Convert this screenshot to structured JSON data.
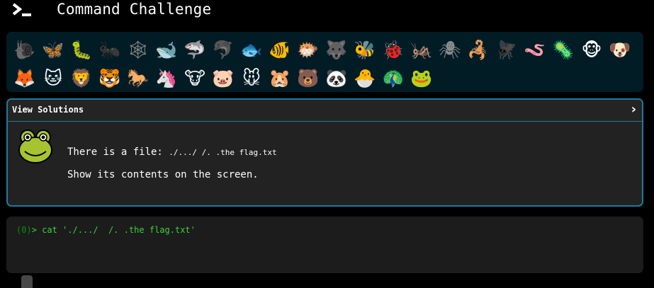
{
  "header": {
    "title": "Command Challenge",
    "logo_icon": "terminal-prompt-icon"
  },
  "animals": {
    "row1": [
      {
        "name": "snail",
        "glyph": "🐌",
        "locked": true
      },
      {
        "name": "butterfly",
        "glyph": "🦋",
        "locked": false
      },
      {
        "name": "caterpillar",
        "glyph": "🐛",
        "locked": false
      },
      {
        "name": "ant",
        "glyph": "🐜",
        "locked": true
      },
      {
        "name": "spider-web",
        "glyph": "🕸",
        "locked": true
      },
      {
        "name": "whale",
        "glyph": "🐋",
        "locked": false
      },
      {
        "name": "shark",
        "glyph": "🦈",
        "locked": false
      },
      {
        "name": "dolphin",
        "glyph": "🐬",
        "locked": true
      },
      {
        "name": "fish",
        "glyph": "🐟",
        "locked": false
      },
      {
        "name": "tropical-fish",
        "glyph": "🐠",
        "locked": false
      },
      {
        "name": "pufferfish",
        "glyph": "🐡",
        "locked": false
      },
      {
        "name": "wolf",
        "glyph": "🐺",
        "locked": true
      },
      {
        "name": "bee",
        "glyph": "🐝",
        "locked": false
      },
      {
        "name": "ladybug",
        "glyph": "🐞",
        "locked": false
      },
      {
        "name": "cricket",
        "glyph": "🦗",
        "locked": false
      },
      {
        "name": "spider",
        "glyph": "🕷",
        "locked": true
      },
      {
        "name": "scorpion",
        "glyph": "🦂",
        "locked": false
      },
      {
        "name": "fly",
        "glyph": "🪰",
        "locked": true
      },
      {
        "name": "worm",
        "glyph": "🪱",
        "locked": false
      },
      {
        "name": "microbe",
        "glyph": "🦠",
        "locked": false
      },
      {
        "name": "monkey",
        "glyph": "🐵",
        "locked": false
      },
      {
        "name": "dog",
        "glyph": "🐶",
        "locked": false
      }
    ],
    "row2": [
      {
        "name": "fox",
        "glyph": "🦊",
        "locked": false
      },
      {
        "name": "cat",
        "glyph": "🐱",
        "locked": false
      },
      {
        "name": "lion",
        "glyph": "🦁",
        "locked": false
      },
      {
        "name": "tiger",
        "glyph": "🐯",
        "locked": false
      },
      {
        "name": "horse",
        "glyph": "🐎",
        "locked": false
      },
      {
        "name": "unicorn",
        "glyph": "🦄",
        "locked": false
      },
      {
        "name": "cow",
        "glyph": "🐮",
        "locked": false
      },
      {
        "name": "pig",
        "glyph": "🐷",
        "locked": false
      },
      {
        "name": "mouse",
        "glyph": "🐭",
        "locked": false
      },
      {
        "name": "hamster",
        "glyph": "🐹",
        "locked": false
      },
      {
        "name": "bear",
        "glyph": "🐻",
        "locked": false
      },
      {
        "name": "panda",
        "glyph": "🐼",
        "locked": false
      },
      {
        "name": "hatching-chick",
        "glyph": "🐣",
        "locked": false
      },
      {
        "name": "peacock",
        "glyph": "🦚",
        "locked": false
      },
      {
        "name": "frog",
        "glyph": "🐸",
        "locked": false
      }
    ]
  },
  "solutions": {
    "title": "View Solutions",
    "expand_icon": "chevron-right-icon"
  },
  "challenge": {
    "avatar_icon": "frog-icon",
    "line1_prefix": "There is a file: ",
    "file_path": "./.../ /. .the flag.txt",
    "line2": "Show its contents on the screen."
  },
  "terminal": {
    "status": "(0)",
    "prompt": "> ",
    "command": "cat './.../  /. .the flag.txt'"
  },
  "colors": {
    "background": "#000000",
    "animal_bar": "#021c26",
    "panel_border": "#1d7d9c",
    "terminal_text": "#3bd13b"
  }
}
